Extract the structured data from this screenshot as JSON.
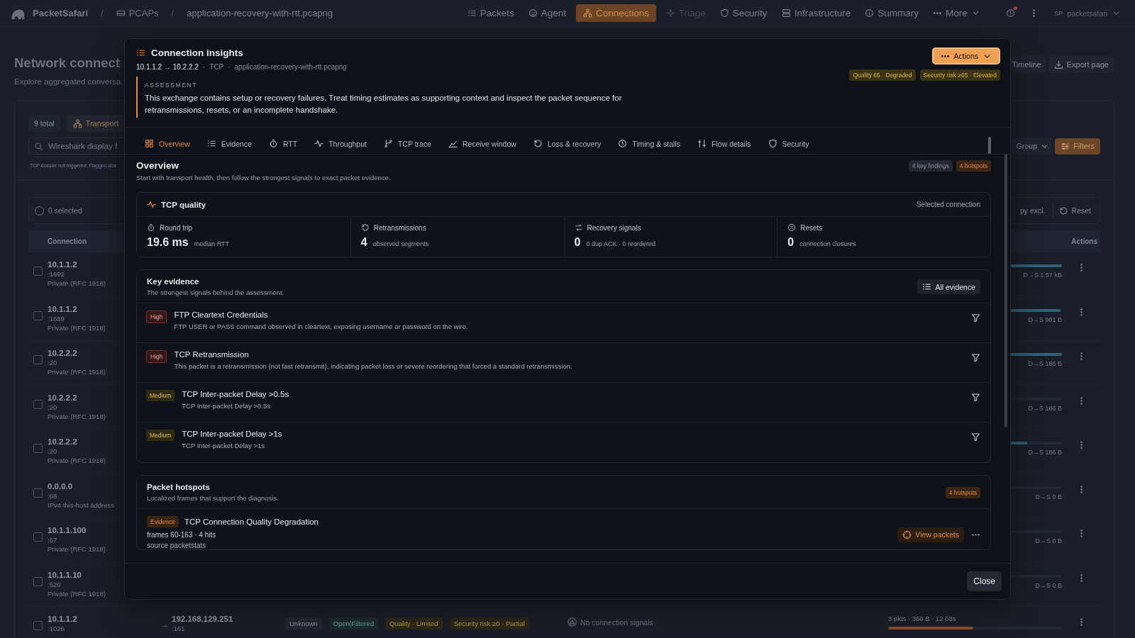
{
  "nav": {
    "brand": "PacketSafari",
    "breadcrumbs": [
      {
        "separator": "/",
        "label": "PCAPs",
        "kind": "folder"
      },
      {
        "separator": "/",
        "label": "application-recovery-with-rtt.pcapng",
        "kind": "file"
      }
    ],
    "tabs": [
      {
        "label": "Packets",
        "selected": false,
        "disabled": false
      },
      {
        "label": "Agent",
        "selected": false,
        "disabled": false
      },
      {
        "label": "Connections",
        "selected": true,
        "disabled": false
      },
      {
        "label": "Triage",
        "selected": false,
        "disabled": true
      },
      {
        "label": "Security",
        "selected": false,
        "disabled": false
      },
      {
        "label": "Infrastructure",
        "selected": false,
        "disabled": false
      },
      {
        "label": "Summary",
        "selected": false,
        "disabled": false
      }
    ],
    "more": "More",
    "unread_notifications": true,
    "user": {
      "initials": "SP",
      "name": "packetsafari"
    }
  },
  "page": {
    "title": "Network connect",
    "subtitle": "Explore aggregated conversa",
    "header_actions": [
      {
        "label": "Timeline",
        "kind": "timeline"
      },
      {
        "label": "Export page",
        "kind": "export"
      }
    ],
    "filters": {
      "total": "9 total",
      "group_chip": "Transport",
      "search_placeholder": "Wireshark display f",
      "note": "TCP dossier not triggered: Flagged dos",
      "group_select": "Group",
      "filters_button": "Filters"
    },
    "selection": {
      "label": "0 selected",
      "checked": false
    },
    "bulk_actions": [
      {
        "label": "py excl.",
        "kind": "copy"
      },
      {
        "label": "Reset",
        "kind": "reset"
      }
    ],
    "columns": [
      "Connection",
      "Actions"
    ],
    "rows": [
      {
        "address": "10.1.1.2",
        "port": ":1692",
        "scope": "Private (RFC 1918)",
        "checked": false,
        "level": 1.0,
        "color": "#2f6177",
        "traffic": "D→S 1.57 kB"
      },
      {
        "address": "10.1.1.2",
        "port": ":1689",
        "scope": "Private (RFC 1918)",
        "checked": false,
        "level": 0.99,
        "color": "#2f6177",
        "traffic": "D→S 901 B"
      },
      {
        "address": "10.2.2.2",
        "port": ":20",
        "scope": "Private (RFC 1918)",
        "checked": false,
        "level": 1.0,
        "color": "#2f6177",
        "traffic": "D→S 186 B"
      },
      {
        "address": "10.2.2.2",
        "port": ":20",
        "scope": "Private (RFC 1918)",
        "checked": false,
        "level": 0.0,
        "traffic": "D→S 186 B"
      },
      {
        "address": "10.2.2.2",
        "port": ":20",
        "scope": "Private (RFC 1918)",
        "checked": false,
        "level": 0.8,
        "color": "#2f6177",
        "traffic": "D→S 186 B"
      },
      {
        "address": "0.0.0.0",
        "port": ":68",
        "scope": "IPv4 this-host address",
        "checked": false,
        "level": 0.0,
        "traffic": "D→S 0 B"
      },
      {
        "address": "10.1.1.100",
        "port": ":67",
        "scope": "Private (RFC 1918)",
        "checked": false,
        "level": 0.0,
        "traffic": "D→S 0 B"
      },
      {
        "address": "10.1.1.10",
        "port": ":520",
        "scope": "Private (RFC 1918)",
        "checked": false,
        "level": 0.0,
        "traffic": "D→S 0 B"
      },
      {
        "address": "10.1.1.2",
        "port": ":1026",
        "checked": false,
        "peer": "192.168.129.251",
        "peer_port": ":161",
        "badges": [
          {
            "label": "Unknown",
            "kind": "neutral"
          },
          {
            "label": "Open|Filtered",
            "kind": "info"
          },
          {
            "label": "Quality · Limited",
            "kind": "warn"
          },
          {
            "label": "Security risk ≥0 · Partial",
            "kind": "warn"
          }
        ],
        "signals": "No connection signals",
        "stats": "3 pkts · 360 B · 12.03s",
        "level": 0.49,
        "color": "#8a4d26"
      }
    ]
  },
  "modal": {
    "title": "Connection insights",
    "meta": [
      {
        "text": "10.1.1.2 → 10.2.2.2",
        "kind": "route"
      },
      {
        "text": "·",
        "kind": "separator"
      },
      {
        "text": "TCP",
        "kind": "protocol"
      },
      {
        "text": "·",
        "kind": "separator"
      },
      {
        "text": "application-recovery-with-rtt.pcapng",
        "kind": "file"
      }
    ],
    "actions": "Actions",
    "badges": [
      "Quality 65 · Degraded",
      "Security risk ≥65 · Elevated"
    ],
    "assessment": {
      "label": "ASSESSMENT",
      "text": "This exchange contains setup or recovery failures. Treat timing estimates as supporting context and inspect the packet sequence for retransmissions, resets, or an incomplete handshake."
    },
    "tabs": [
      {
        "label": "Overview",
        "selected": true
      },
      {
        "label": "Evidence",
        "selected": false
      },
      {
        "label": "RTT",
        "selected": false
      },
      {
        "label": "Throughput",
        "selected": false
      },
      {
        "label": "TCP trace",
        "selected": false
      },
      {
        "label": "Receive window",
        "selected": false
      },
      {
        "label": "Loss & recovery",
        "selected": false
      },
      {
        "label": "Timing & stalls",
        "selected": false
      },
      {
        "label": "Flow details",
        "selected": false
      },
      {
        "label": "Security",
        "selected": false
      }
    ],
    "overview": {
      "title": "Overview",
      "subtitle": "Start with transport health, then follow the strongest signals to exact packet evidence.",
      "badges": [
        {
          "label": "4 key findings",
          "kind": "neutral"
        },
        {
          "label": "4 hotspots",
          "kind": "accent"
        }
      ]
    },
    "tcp_quality": {
      "title": "TCP quality",
      "scope": "Selected connection",
      "metrics": [
        {
          "label": "Round trip",
          "value": "19.6 ms",
          "detail": "median RTT"
        },
        {
          "label": "Retransmissions",
          "value": "4",
          "detail": "observed segments"
        },
        {
          "label": "Recovery signals",
          "value": "0",
          "detail": "0 dup ACK · 0 reordered"
        },
        {
          "label": "Resets",
          "value": "0",
          "detail": "connection closures"
        }
      ]
    },
    "key_evidence": {
      "title": "Key evidence",
      "subtitle": "The strongest signals behind the assessment.",
      "button": "All evidence",
      "findings": [
        {
          "severity": "High",
          "kind": "high",
          "title": "FTP Cleartext Credentials",
          "detail": "FTP USER or PASS command observed in cleartext, exposing username or password on the wire."
        },
        {
          "severity": "High",
          "kind": "high",
          "title": "TCP Retransmission",
          "detail": "This packet is a retransmission (not fast retransmit), indicating packet loss or severe reordering that forced a standard retransmission."
        },
        {
          "severity": "Medium",
          "kind": "medium",
          "title": "TCP Inter-packet Delay >0.5s",
          "detail": "TCP Inter-packet Delay >0.5s"
        },
        {
          "severity": "Medium",
          "kind": "medium",
          "title": "TCP Inter-packet Delay >1s",
          "detail": "TCP Inter-packet Delay >1s"
        }
      ]
    },
    "hotspots": {
      "title": "Packet hotspots",
      "subtitle": "Localized frames that support the diagnosis.",
      "count": "4 hotspots",
      "items": [
        {
          "tag": "Evidence",
          "title": "TCP Connection Quality Degradation",
          "frames": "frames 60-163 · 4 hits",
          "source": "source packetstats",
          "action": "View packets"
        }
      ]
    },
    "close": "Close"
  }
}
